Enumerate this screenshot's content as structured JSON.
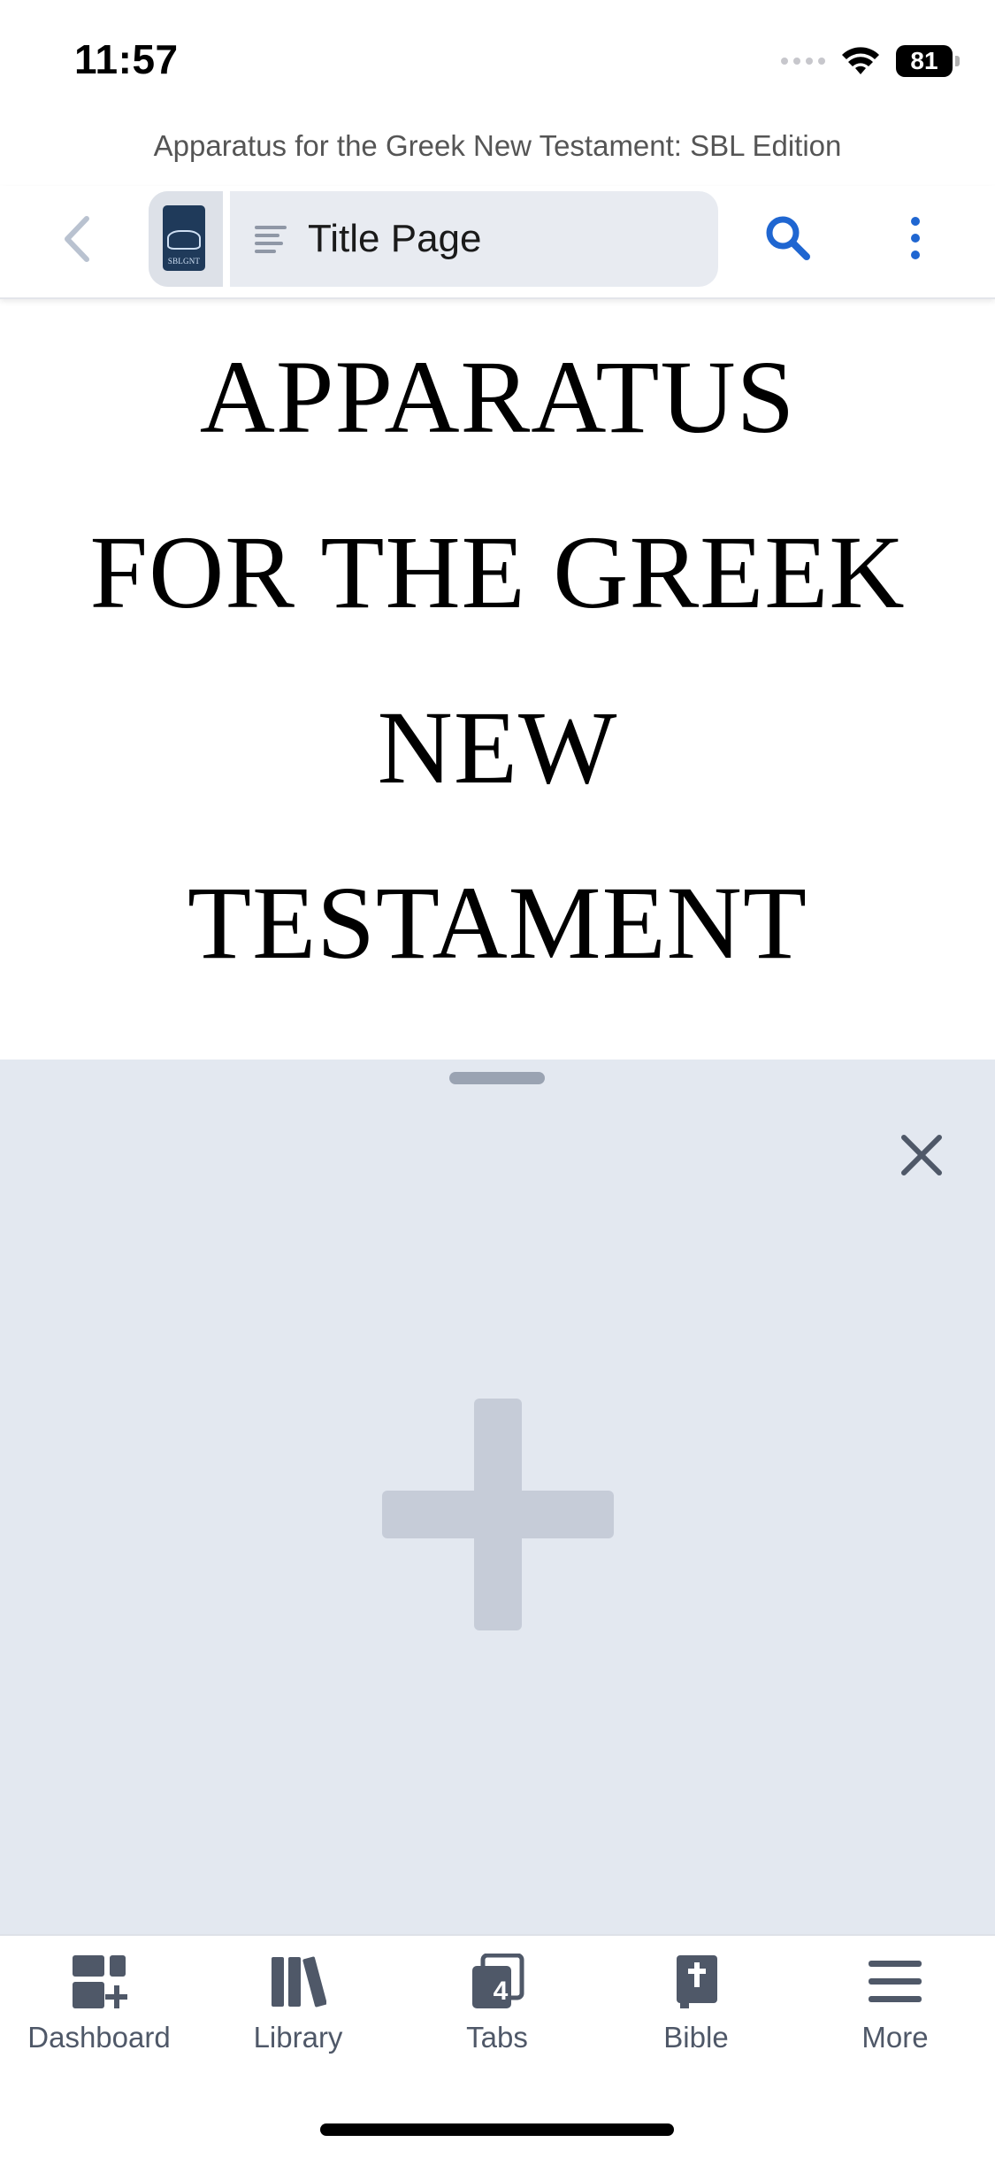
{
  "status_bar": {
    "time": "11:57",
    "battery": "81"
  },
  "book": {
    "title": "Apparatus for the Greek New Testament: SBL Edition",
    "thumbnail_label": "SBLGNT"
  },
  "toolbar": {
    "back_icon": "chevron-left-icon",
    "section": "Title Page",
    "toc_icon": "list-icon",
    "search_icon": "search-icon",
    "more_icon": "vertical-ellipsis-icon"
  },
  "content": {
    "title_lines": [
      "APPARATUS",
      "FOR THE GREEK",
      "NEW",
      "TESTAMENT"
    ]
  },
  "panel": {
    "close_icon": "close-icon",
    "add_icon": "plus-icon"
  },
  "tabbar": {
    "items": [
      {
        "label": "Dashboard",
        "icon": "dashboard-icon"
      },
      {
        "label": "Library",
        "icon": "library-icon"
      },
      {
        "label": "Tabs",
        "icon": "tabs-icon",
        "badge": "4"
      },
      {
        "label": "Bible",
        "icon": "bible-icon"
      },
      {
        "label": "More",
        "icon": "menu-icon"
      }
    ]
  },
  "colors": {
    "accent": "#1f66d1",
    "panel_bg": "#e3e8f0",
    "icon_gray": "#4f5868",
    "plus_gray": "#c6ccd8"
  }
}
